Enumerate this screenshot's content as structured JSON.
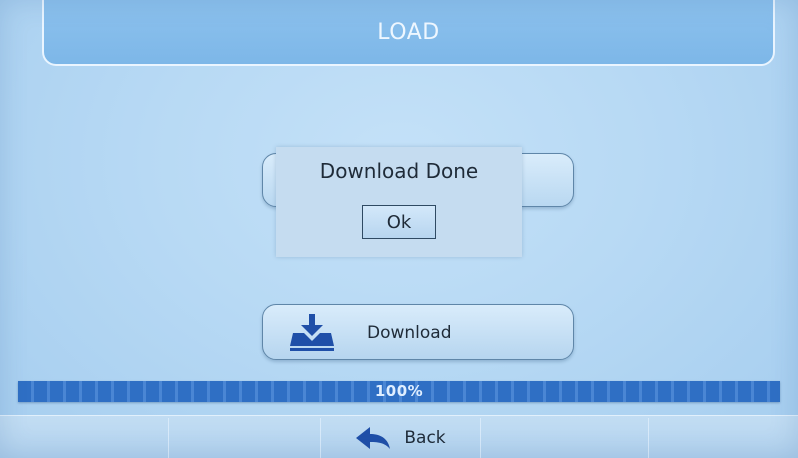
{
  "header": {
    "title": "LOAD"
  },
  "dialog": {
    "message": "Download Done",
    "ok_label": "Ok"
  },
  "download_button": {
    "label": "Download",
    "icon": "download-tray-icon"
  },
  "progress": {
    "text": "100%",
    "fraction": 1.0
  },
  "footer": {
    "back_label": "Back",
    "back_icon": "back-arrow-icon"
  },
  "colors": {
    "accent": "#1f4fa8",
    "progress_fill": "#2f6fc4",
    "background": "#b7d9f4"
  }
}
